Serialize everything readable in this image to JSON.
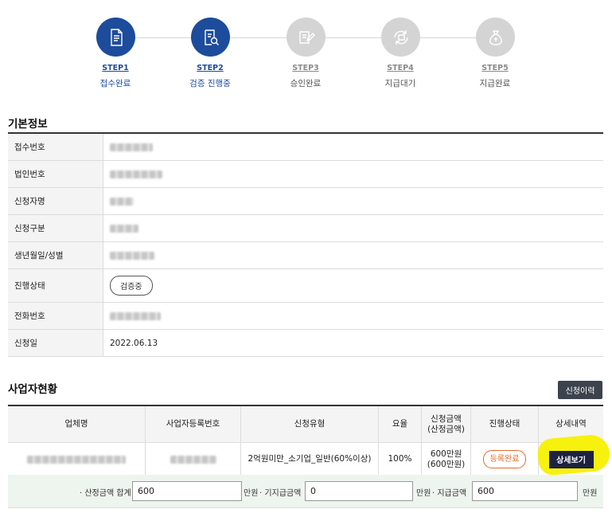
{
  "steps": [
    {
      "no": "STEP1",
      "name": "접수완료",
      "state": "active"
    },
    {
      "no": "STEP2",
      "name": "검증 진행중",
      "state": "active"
    },
    {
      "no": "STEP3",
      "name": "승인완료",
      "state": "inactive"
    },
    {
      "no": "STEP4",
      "name": "지급대기",
      "state": "inactive"
    },
    {
      "no": "STEP5",
      "name": "지급완료",
      "state": "inactive"
    }
  ],
  "basic": {
    "title": "기본정보",
    "rows": [
      {
        "label": "접수번호"
      },
      {
        "label": "법인번호"
      },
      {
        "label": "신청자명"
      },
      {
        "label": "신청구분"
      },
      {
        "label": "생년월일/성별"
      },
      {
        "label": "진행상태",
        "status": "검증중"
      },
      {
        "label": "전화번호"
      },
      {
        "label": "신청일",
        "value": "2022.06.13"
      }
    ]
  },
  "biz": {
    "title": "사업자현황",
    "history_button": "신청이력",
    "headers": [
      "업체명",
      "사업자등록번호",
      "신청유형",
      "요율",
      "신청금액\n(산정금액)",
      "진행상태",
      "상세내역"
    ],
    "row": {
      "type": "2억원미만_소기업_일반(60%이상)",
      "rate": "100%",
      "amount_line1": "600만원",
      "amount_line2": "(600만원)",
      "status": "등록완료",
      "detail_button": "상세보기"
    }
  },
  "totals": {
    "sum_label": "· 산정금액 합계",
    "sum_value": "600",
    "unit1": "만원",
    "paid_label": "· 기지급금액",
    "paid_value": "0",
    "unit2": "만원",
    "pay_label": "· 지급금액",
    "pay_value": "600",
    "unit3": "만원"
  },
  "colors": {
    "active_step": "#1d4c9c",
    "inactive_step": "#d4d4d4",
    "register_pill": "#e66a2c",
    "detail_button": "#1e2240",
    "highlight": "#f7f10e",
    "totals_bg": "#eef4ee"
  },
  "icons": [
    "document-icon",
    "search-document-icon",
    "approval-stamp-icon",
    "money-transfer-icon",
    "money-bag-icon"
  ]
}
